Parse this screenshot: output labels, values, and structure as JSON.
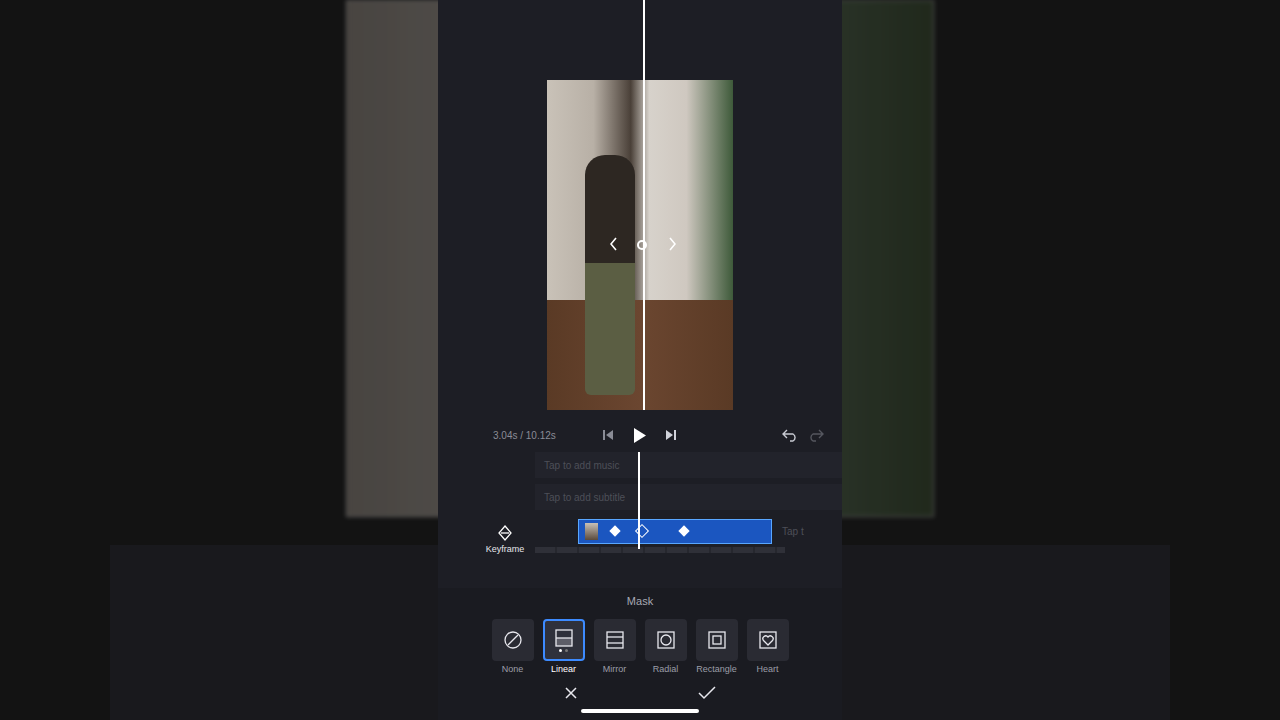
{
  "player": {
    "time": "3.04s / 10.12s"
  },
  "tracks": {
    "music": "Tap to add music",
    "subtitle": "Tap to add subtitle",
    "after_clip": "Tap t"
  },
  "keyframe_button": {
    "label": "Keyframe"
  },
  "clip": {
    "keyframes": [
      {
        "selected": false
      },
      {
        "selected": true
      },
      {
        "selected": false
      }
    ]
  },
  "mask": {
    "title": "Mask",
    "options": [
      {
        "label": "None",
        "selected": false,
        "kind": "none"
      },
      {
        "label": "Linear",
        "selected": true,
        "kind": "linear"
      },
      {
        "label": "Mirror",
        "selected": false,
        "kind": "mirror"
      },
      {
        "label": "Radial",
        "selected": false,
        "kind": "radial"
      },
      {
        "label": "Rectangle",
        "selected": false,
        "kind": "rectangle"
      },
      {
        "label": "Heart",
        "selected": false,
        "kind": "heart"
      }
    ]
  }
}
